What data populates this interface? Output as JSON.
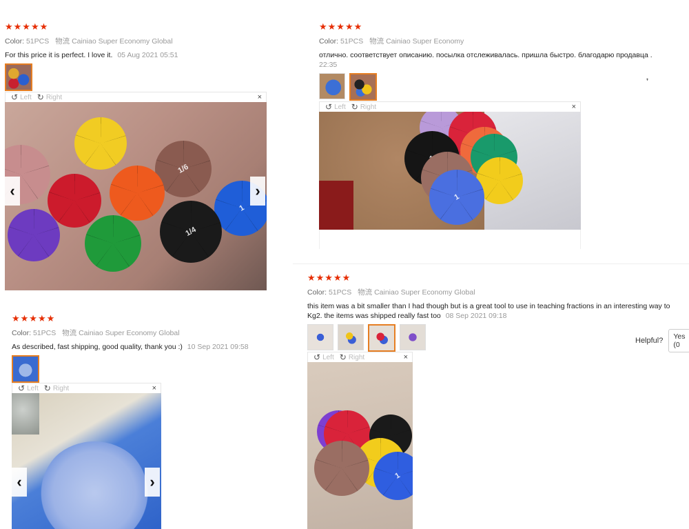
{
  "reviews": [
    {
      "stars": "★★★★★",
      "color_label": "Color:",
      "color_value": "51PCS",
      "ship_label": "物流",
      "ship_value": "Cainiao Super Economy Global",
      "text": "For this price it is perfect. I love it.",
      "date": "05 Aug 2021 05:51"
    },
    {
      "stars": "★★★★★",
      "color_label": "Color:",
      "color_value": "51PCS",
      "ship_label": "物流",
      "ship_value": "Cainiao Super Economy",
      "text": "отлично. соответствует описанию. посылка отслеживалась. пришла быстро. благодарю продавца .",
      "date": "22:35"
    },
    {
      "stars": "★★★★★",
      "color_label": "Color:",
      "color_value": "51PCS",
      "ship_label": "物流",
      "ship_value": "Cainiao Super Economy Global",
      "text": "As described, fast shipping, good quality, thank you :)",
      "date": "10 Sep 2021 09:58"
    },
    {
      "stars": "★★★★★",
      "color_label": "Color:",
      "color_value": "51PCS",
      "ship_label": "物流",
      "ship_value": "Cainiao Super Economy Global",
      "text": "this item was a bit smaller than I had though but is a great tool to use in teaching fractions in an interesting way to Kg2. the items was shipped really fast too",
      "date": "08 Sep 2021 09:18"
    }
  ],
  "viewer": {
    "left_label": "Left",
    "right_label": "Right",
    "close_glyph": "×",
    "prev_glyph": "‹",
    "next_glyph": "›"
  },
  "helpful": {
    "label": "Helpful?",
    "yes_label": "Yes (0"
  },
  "stray_glyph": "❜"
}
